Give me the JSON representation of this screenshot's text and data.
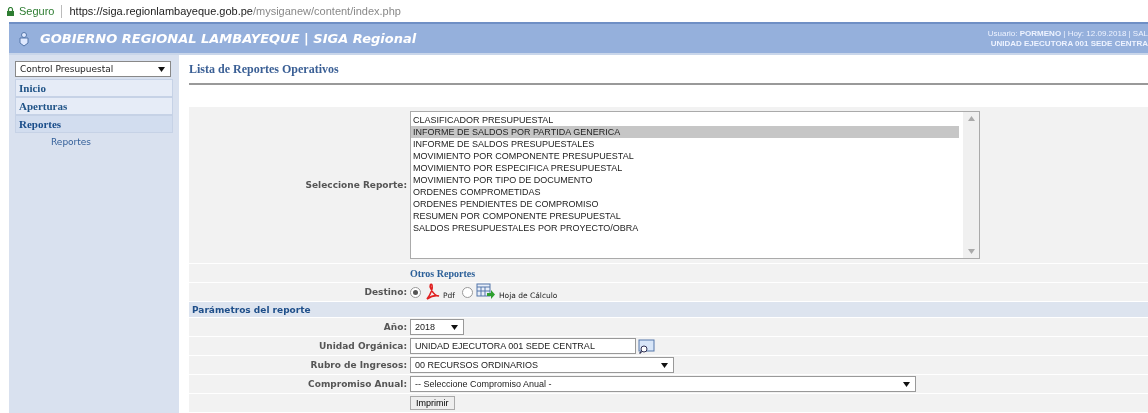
{
  "address_bar": {
    "security": "Seguro",
    "url_host": "https://siga.regionlambayeque.gob.pe",
    "url_path": "/mysiganew/content/index.php"
  },
  "header": {
    "title": "GOBIERNO REGIONAL LAMBAYEQUE | SIGA Regional",
    "user_line": "Usuario: **PORMENO** | Hoy: 12.09.2018 | SAL",
    "unit_line": "UNIDAD EJECUTORA 001 SEDE CENTRA"
  },
  "sidebar": {
    "module_select": "Control Presupuestal",
    "items": [
      {
        "label": "Inicio",
        "selected": false
      },
      {
        "label": "Aperturas",
        "selected": false
      },
      {
        "label": "Reportes",
        "selected": true,
        "children": [
          {
            "label": "Reportes"
          }
        ]
      }
    ]
  },
  "page_title": "Lista de Reportes Operativos",
  "report_select": {
    "label": "Seleccione Reporte:",
    "options": [
      {
        "label": "CLASIFICADOR PRESUPUESTAL",
        "selected": false
      },
      {
        "label": "INFORME DE SALDOS POR PARTIDA GENERICA",
        "selected": true
      },
      {
        "label": "INFORME DE SALDOS PRESUPUESTALES",
        "selected": false
      },
      {
        "label": "MOVIMIENTO POR COMPONENTE PRESUPUESTAL",
        "selected": false
      },
      {
        "label": "MOVIMIENTO POR ESPECIFICA PRESUPUESTAL",
        "selected": false
      },
      {
        "label": "MOVIMIENTO POR TIPO DE DOCUMENTO",
        "selected": false
      },
      {
        "label": "ORDENES COMPROMETIDAS",
        "selected": false
      },
      {
        "label": "ORDENES PENDIENTES DE COMPROMISO",
        "selected": false
      },
      {
        "label": "RESUMEN POR COMPONENTE PRESUPUESTAL",
        "selected": false
      },
      {
        "label": "SALDOS PRESUPUESTALES POR PROYECTO/OBRA",
        "selected": false
      }
    ]
  },
  "other_reports": "Otros Reportes",
  "destination": {
    "label": "Destino:",
    "options": [
      {
        "label": "Pdf",
        "kind": "pdf",
        "selected": true
      },
      {
        "label": "Hoja de Cálculo",
        "kind": "sheet",
        "selected": false
      }
    ]
  },
  "parameters": {
    "title": "Parámetros del reporte",
    "fields": [
      {
        "label": "Año:",
        "kind": "short-select",
        "value": "2018"
      },
      {
        "label": "Unidad Orgánica:",
        "kind": "lookup",
        "value": "UNIDAD EJECUTORA 001 SEDE CENTRAL"
      },
      {
        "label": "Rubro de Ingresos:",
        "kind": "select",
        "value": "00 RECURSOS ORDINARIOS"
      },
      {
        "label": "Compromiso Anual:",
        "kind": "wide-select",
        "value": "-- Seleccione Compromiso Anual -"
      }
    ]
  },
  "print_button": "Imprimir"
}
